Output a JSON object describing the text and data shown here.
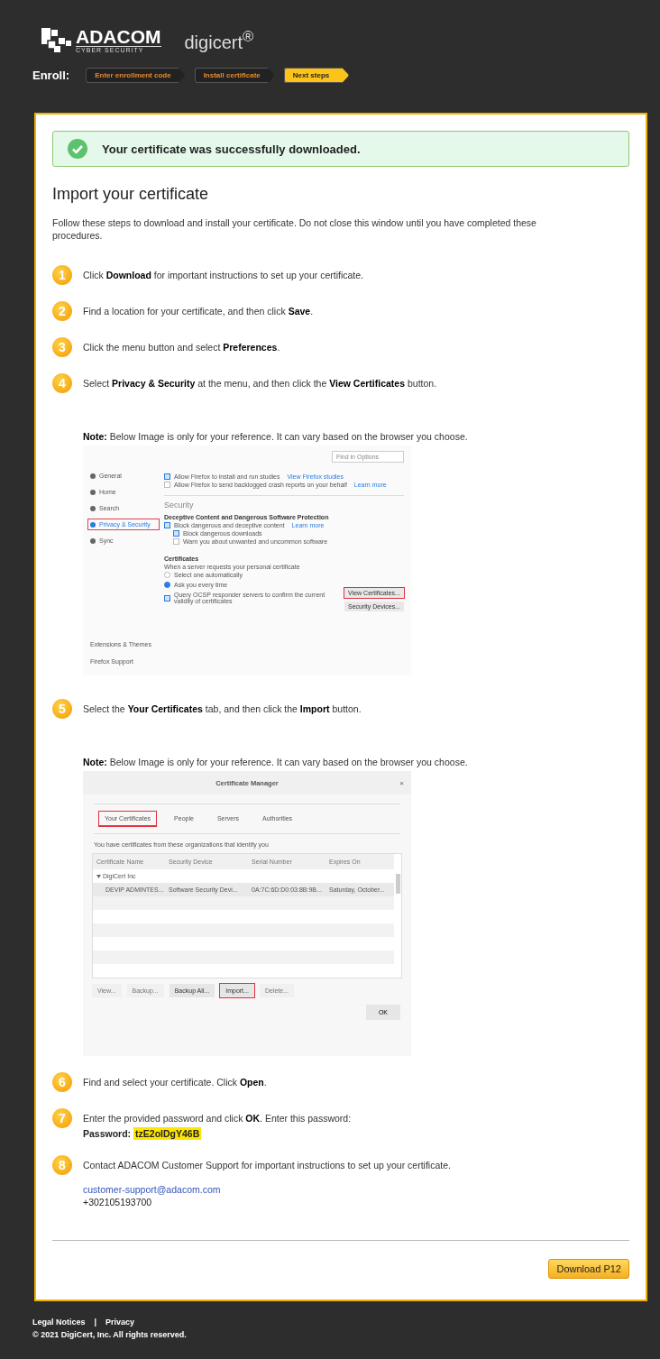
{
  "header": {
    "logo_name": "ADACOM",
    "logo_tagline": "CYBER SECURITY",
    "partner": "digicert$^{®}$"
  },
  "enroll": {
    "label": "Enroll:",
    "steps": [
      {
        "label": "Enter enrollment code",
        "selected": false
      },
      {
        "label": "Install certificate",
        "selected": false
      },
      {
        "label": "Next steps",
        "selected": true
      }
    ]
  },
  "alert": {
    "text": "Your certificate was successfully downloaded."
  },
  "title": "Import your certificate",
  "intro": "Follow these steps to download and install your certificate. Do not close this window until you have completed these procedures.",
  "steps": [
    {
      "number": "1",
      "kind": "plain",
      "text": "Click **Download** for important instructions to set up your certificate."
    },
    {
      "number": "2",
      "kind": "plain",
      "text": "Find a location for your certificate, and then click **Save**."
    },
    {
      "number": "3",
      "kind": "plain",
      "text": "Click the menu button and select **Preferences**."
    },
    {
      "number": "4",
      "kind": "preferences",
      "text": "Select **Privacy & Security** at the menu, and then click the **View Certificates** button.",
      "note": "**Note:** Below Image is only for your reference. It can vary based on the browser you choose.",
      "figure": {
        "search_placeholder": "Find in Options",
        "sidebar": [
          {
            "label": "General",
            "selected": false
          },
          {
            "label": "Home",
            "selected": false
          },
          {
            "label": "Search",
            "selected": false
          },
          {
            "label": "Privacy & Security",
            "selected": true
          },
          {
            "label": "Sync",
            "selected": false
          }
        ],
        "sidebar_bottom": [
          "Extensions & Themes",
          "Firefox Support"
        ],
        "top_rows": [
          {
            "label": "Allow Firefox to install and run studies",
            "link": "View Firefox studies",
            "checked": true
          },
          {
            "label": "Allow Firefox to send backlogged crash reports on your behalf",
            "link": "Learn more",
            "checked": false
          }
        ],
        "section": "Security",
        "protection": {
          "title": "Deceptive Content and Dangerous Software Protection",
          "rows": [
            {
              "label": "Block dangerous and deceptive content",
              "link": "Learn more",
              "checked": true,
              "children": [
                {
                  "label": "Block dangerous downloads",
                  "checked": true
                },
                {
                  "label": "Warn you about unwanted and uncommon software",
                  "checked": false
                }
              ]
            }
          ]
        },
        "certificates": {
          "title": "Certificates",
          "caption": "When a server requests your personal certificate",
          "radios": [
            {
              "label": "Select one automatically",
              "selected": false
            },
            {
              "label": "Ask you every time",
              "selected": true
            }
          ],
          "ocsp": {
            "label": "Query OCSP responder servers to confirm the current validity of certificates",
            "checked": true
          },
          "buttons": [
            {
              "label": "View Certificates...",
              "highlighted": true
            },
            {
              "label": "Security Devices...",
              "highlighted": false
            }
          ]
        }
      }
    },
    {
      "number": "5",
      "kind": "certificates",
      "text": "Select the **Your Certificates** tab, and then click the **Import** button.",
      "note": "**Note:** Below Image is only for your reference. It can vary based on the browser you choose.",
      "figure": {
        "title": "Certificate Manager",
        "close": "×",
        "tabs": [
          {
            "label": "Your Certificates",
            "selected": true
          },
          {
            "label": "People",
            "selected": false
          },
          {
            "label": "Servers",
            "selected": false
          },
          {
            "label": "Authorities",
            "selected": false
          }
        ],
        "caption": "You have certificates from these organizations that identify you",
        "columns": [
          "Certificate Name",
          "Security Device",
          "Serial Number",
          "Expires On"
        ],
        "group": "DigiCert Inc",
        "rows": [
          {
            "cells": [
              "DEVIP ADMINTES...",
              "Software Security Devi...",
              "0A:7C:6D:D0:03:8B:9B...",
              "Saturday, October..."
            ]
          }
        ],
        "buttons": [
          {
            "label": "View...",
            "disabled": true,
            "highlighted": false
          },
          {
            "label": "Backup...",
            "disabled": true,
            "highlighted": false
          },
          {
            "label": "Backup All...",
            "disabled": false,
            "highlighted": false
          },
          {
            "label": "Import...",
            "disabled": false,
            "highlighted": true
          },
          {
            "label": "Delete...",
            "disabled": true,
            "highlighted": false
          }
        ],
        "ok": "OK"
      }
    },
    {
      "number": "6",
      "kind": "plain",
      "text": "Find and select your certificate. Click **Open**."
    },
    {
      "number": "7",
      "kind": "password",
      "text": "Enter the provided password and click **OK**. Enter this password:",
      "password": {
        "label": "Password:",
        "value": "tzE2oIDgY46B"
      }
    },
    {
      "number": "8",
      "kind": "contact",
      "text": "Contact ADACOM Customer Support for important instructions to set up your certificate.",
      "email": "customer-support@adacom.com",
      "phone": "+302105193700"
    }
  ],
  "download_button": "Download P12",
  "footer": {
    "links": [
      "Legal Notices",
      "Privacy"
    ],
    "separator": "|",
    "copyright": "© 2021 DigiCert, Inc. All rights reserved."
  }
}
